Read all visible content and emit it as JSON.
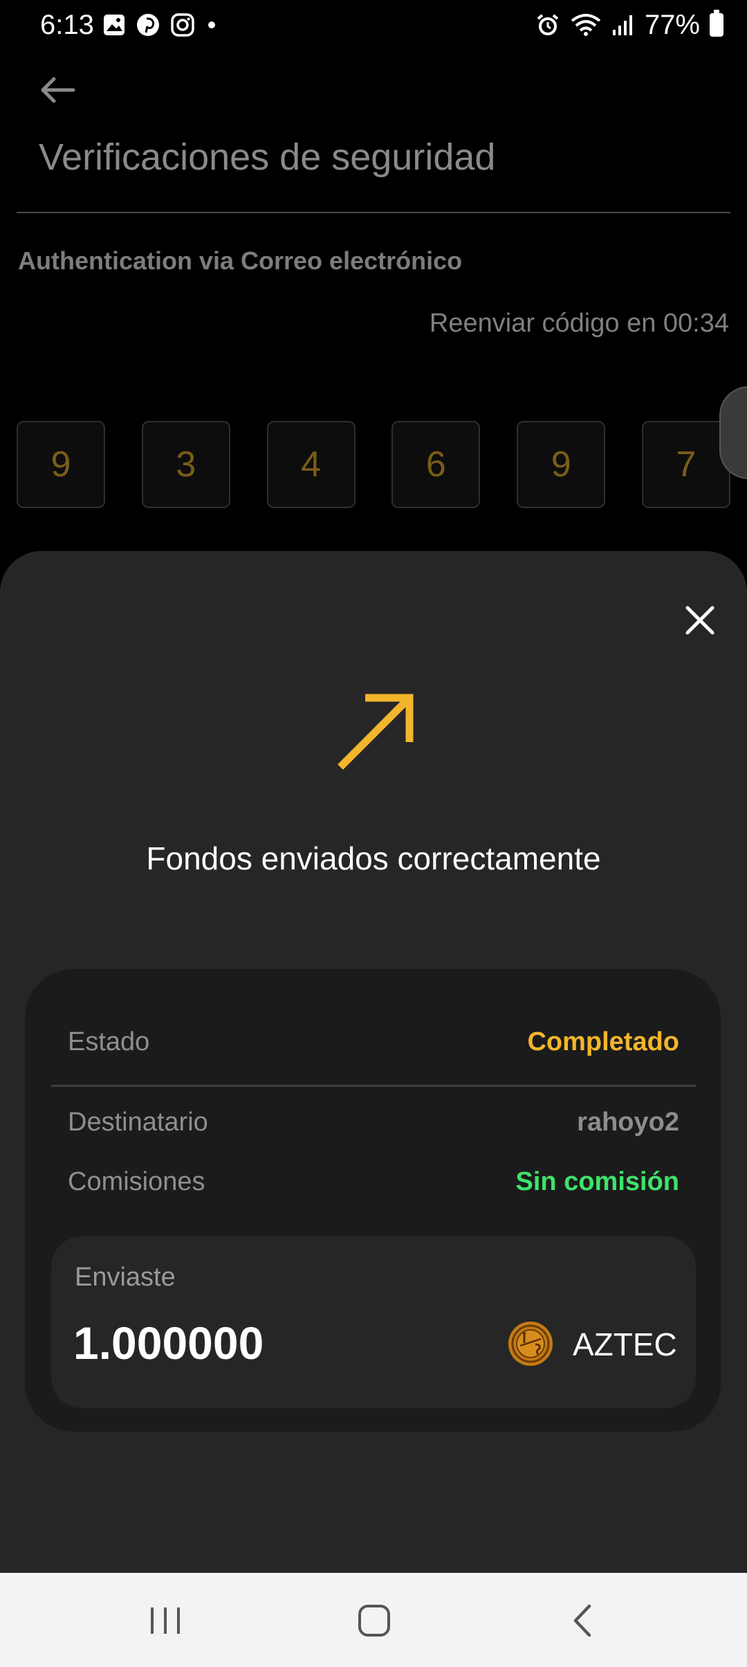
{
  "status_bar": {
    "time": "6:13",
    "battery": "77%",
    "left_icons": [
      "gallery-icon",
      "pinterest-icon",
      "instagram-icon",
      "dot-icon"
    ],
    "right_icons": [
      "alarm-icon",
      "wifi-icon",
      "signal-icon",
      "battery-icon"
    ]
  },
  "page": {
    "title": "Verificaciones de seguridad",
    "auth_label": "Authentication via Correo electrónico",
    "resend_text": "Reenviar código en 00:34",
    "code_digits": [
      "9",
      "3",
      "4",
      "6",
      "9",
      "7"
    ]
  },
  "sheet": {
    "title": "Fondos enviados correctamente",
    "details": {
      "state_label": "Estado",
      "state_value": "Completado",
      "recipient_label": "Destinatario",
      "recipient_value": "rahoyo2",
      "fees_label": "Comisiones",
      "fees_value": "Sin comisión"
    },
    "sent": {
      "label": "Enviaste",
      "amount": "1.000000",
      "coin": "AZTEC"
    }
  },
  "colors": {
    "accent": "#f3b52b",
    "success": "#3fe36a",
    "sheet_bg": "#262626",
    "card_bg": "#1b1b1b"
  }
}
